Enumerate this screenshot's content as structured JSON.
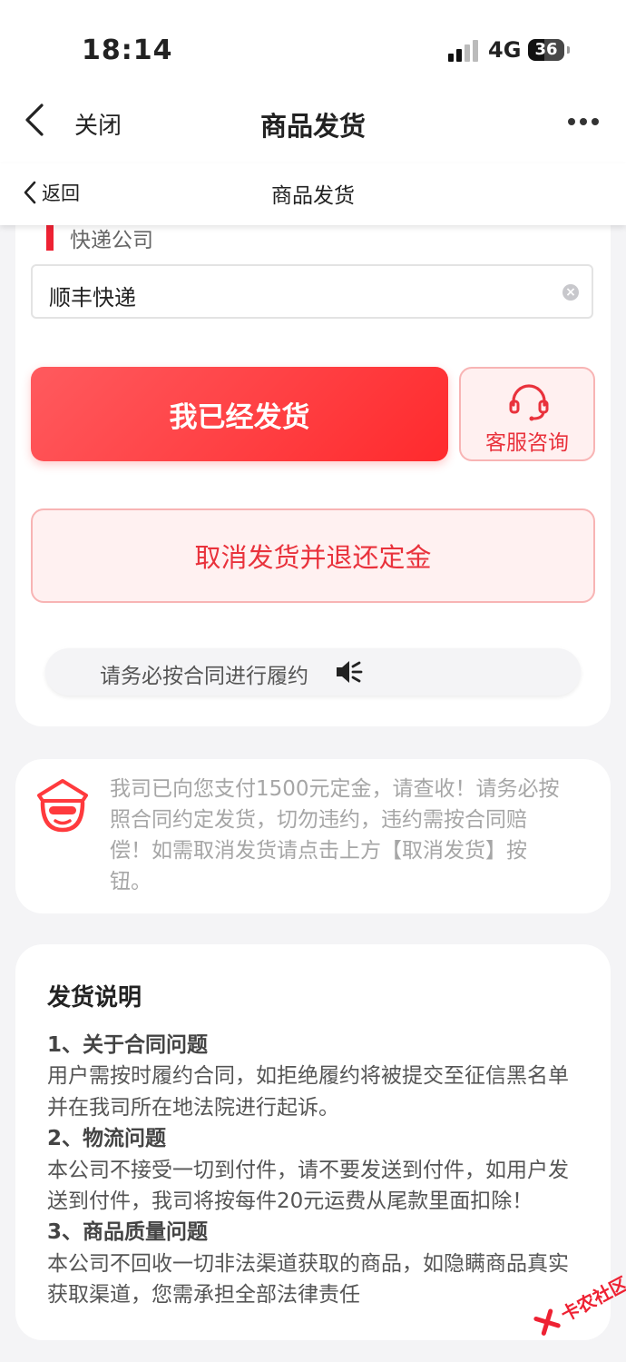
{
  "status_bar": {
    "time": "18:14",
    "network": "4G",
    "battery": "36"
  },
  "nav": {
    "close_label": "关闭",
    "title": "商品发货"
  },
  "subnav": {
    "back_label": "返回",
    "title": "商品发货"
  },
  "form": {
    "courier_label": "快递公司",
    "courier_value": "顺丰快递"
  },
  "actions": {
    "shipped_label": "我已经发货",
    "customer_service_label": "客服咨询",
    "cancel_label": "取消发货并退还定金"
  },
  "notice": {
    "text": "请务必按合同进行履约"
  },
  "message": {
    "text": "我司已向您支付1500元定金，请查收！请务必按照合同约定发货，切勿违约，违约需按合同赔偿！如需取消发货请点击上方【取消发货】按钮。"
  },
  "instructions": {
    "title": "发货说明",
    "items": [
      {
        "heading": "1、关于合同问题",
        "body": "用户需按时履约合同，如拒绝履约将被提交至征信黑名单并在我司所在地法院进行起诉。"
      },
      {
        "heading": "2、物流问题",
        "body": "本公司不接受一切到付件，请不要发送到付件，如用户发送到付件，我司将按每件20元运费从尾款里面扣除！"
      },
      {
        "heading": "3、商品质量问题",
        "body": "本公司不回收一切非法渠道获取的商品，如隐瞒商品真实获取渠道，您需承担全部法律责任"
      }
    ]
  },
  "watermark": {
    "text": "卡农社区"
  },
  "colors": {
    "accent": "#ff2a2d",
    "accent_text": "#e9323c",
    "muted_text": "#a6a6a6"
  }
}
